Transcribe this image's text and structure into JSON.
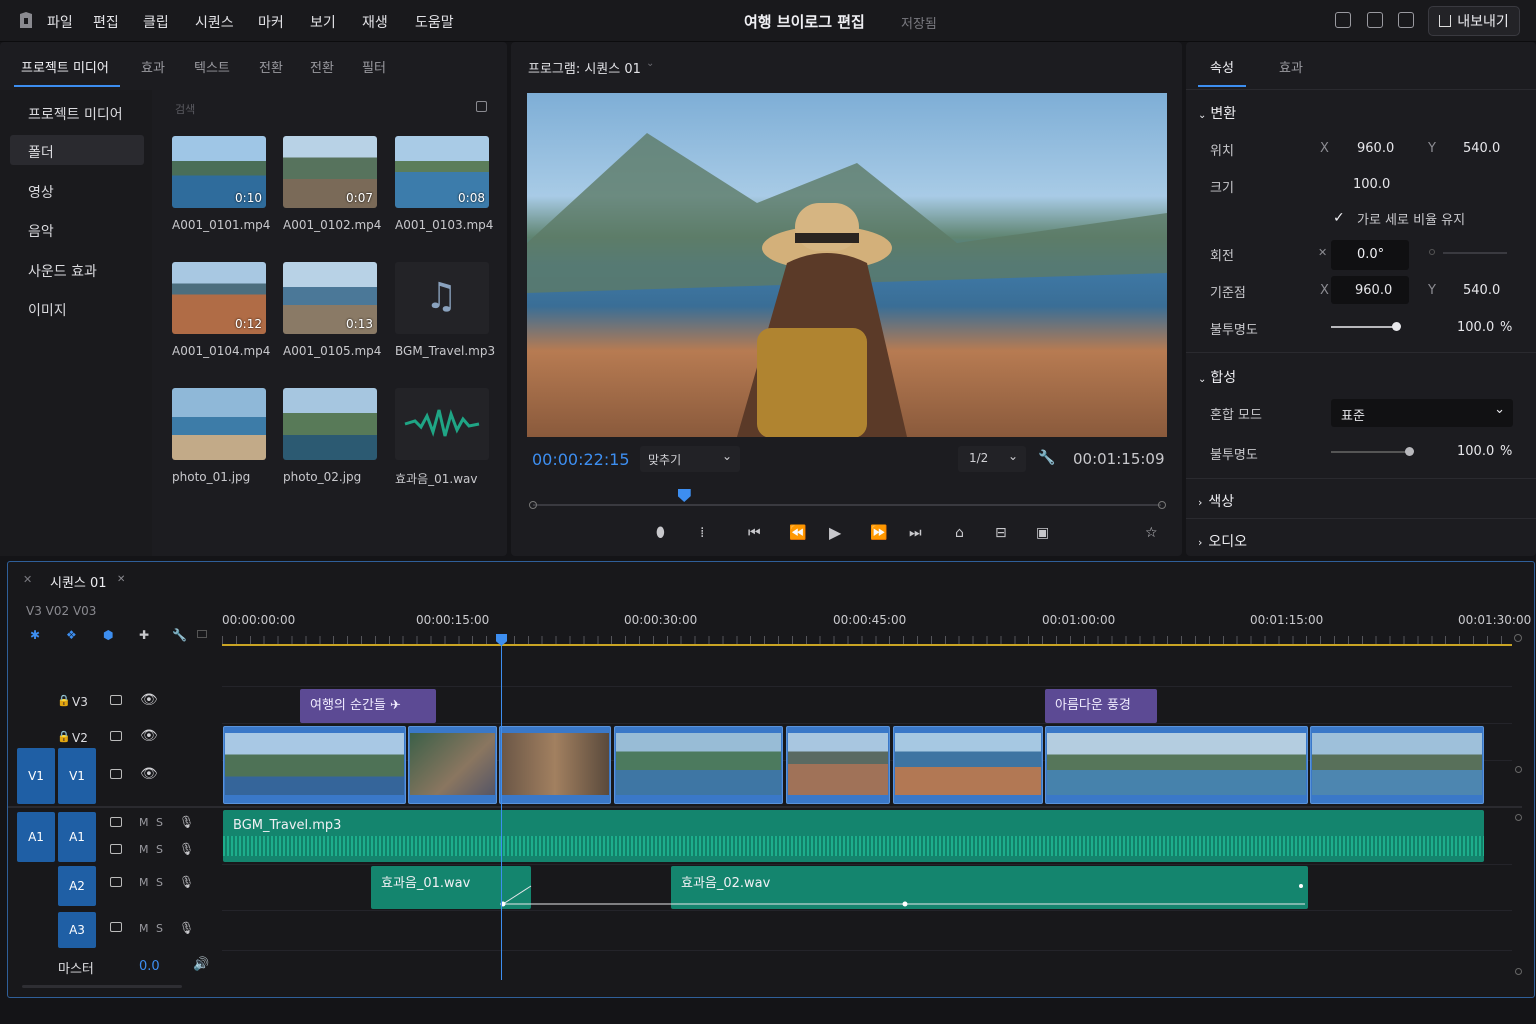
{
  "menu": [
    "파일",
    "편집",
    "클립",
    "시퀀스",
    "마커",
    "보기",
    "재생",
    "도움말"
  ],
  "app_title": "여행 브이로그 편집",
  "save_status": "저장됨",
  "export_label": "내보내기",
  "media_panel": {
    "tabs": [
      "프로젝트 미디어",
      "효과",
      "텍스트",
      "전환",
      "전환",
      "필터"
    ],
    "sidebar": [
      "프로젝트 미디어",
      "폴더",
      "영상",
      "음악",
      "사운드 효과",
      "이미지"
    ],
    "search_placeholder": "검색",
    "items": [
      {
        "name": "A001_0101.mp4",
        "duration": "0:10"
      },
      {
        "name": "A001_0102.mp4",
        "duration": "0:07"
      },
      {
        "name": "A001_0103.mp4",
        "duration": "0:08"
      },
      {
        "name": "A001_0104.mp4",
        "duration": "0:12"
      },
      {
        "name": "A001_0105.mp4",
        "duration": "0:13"
      },
      {
        "name": "BGM_Travel.mp3",
        "duration": ""
      },
      {
        "name": "photo_01.jpg",
        "duration": ""
      },
      {
        "name": "photo_02.jpg",
        "duration": ""
      },
      {
        "name": "효과음_01.wav",
        "duration": ""
      }
    ]
  },
  "program": {
    "title": "프로그램: 시퀀스 01",
    "timecode": "00:00:22:15",
    "fit": "맞추기",
    "resolution": "1/2",
    "duration": "00:01:15:09",
    "playhead_fraction": 0.24
  },
  "properties": {
    "tabs": [
      "속성",
      "효과"
    ],
    "transform": "변환",
    "position_label": "위치",
    "position_x": "960.0",
    "position_y": "540.0",
    "scale_label": "크기",
    "scale": "100.0",
    "uniform_label": "가로 세로 비율 유지",
    "rotation_label": "회전",
    "rotation": "0.0°",
    "anchor_label": "기준점",
    "anchor_x": "960.0",
    "anchor_y": "540.0",
    "opacity_label": "불투명도",
    "opacity": "100.0",
    "percent": "%",
    "x": "X",
    "y": "Y",
    "composite": "합성",
    "blend_label": "혼합 모드",
    "blend_value": "표준",
    "opacity2_label": "불투명도",
    "opacity2": "100.0",
    "color": "색상",
    "audio": "오디오"
  },
  "timeline": {
    "sequence_tab": "시퀀스 01",
    "header_tracks": "V3  V02  V03",
    "ruler": [
      "00:00:00:00",
      "00:00:15:00",
      "00:00:30:00",
      "00:00:45:00",
      "00:01:00:00",
      "00:01:15:00",
      "00:01:30:00"
    ],
    "tracks": {
      "v3": "V3",
      "v2": "V2",
      "v1": "V1",
      "a1": "A1",
      "a2": "A2",
      "a3": "A3",
      "ms": "M S"
    },
    "titles": [
      "여행의 순간들 ✈",
      "아름다운 풍경"
    ],
    "audio_clips": [
      "BGM_Travel.mp3",
      "효과음_01.wav",
      "효과음_02.wav"
    ],
    "master_label": "마스터",
    "master_value": "0.0"
  }
}
